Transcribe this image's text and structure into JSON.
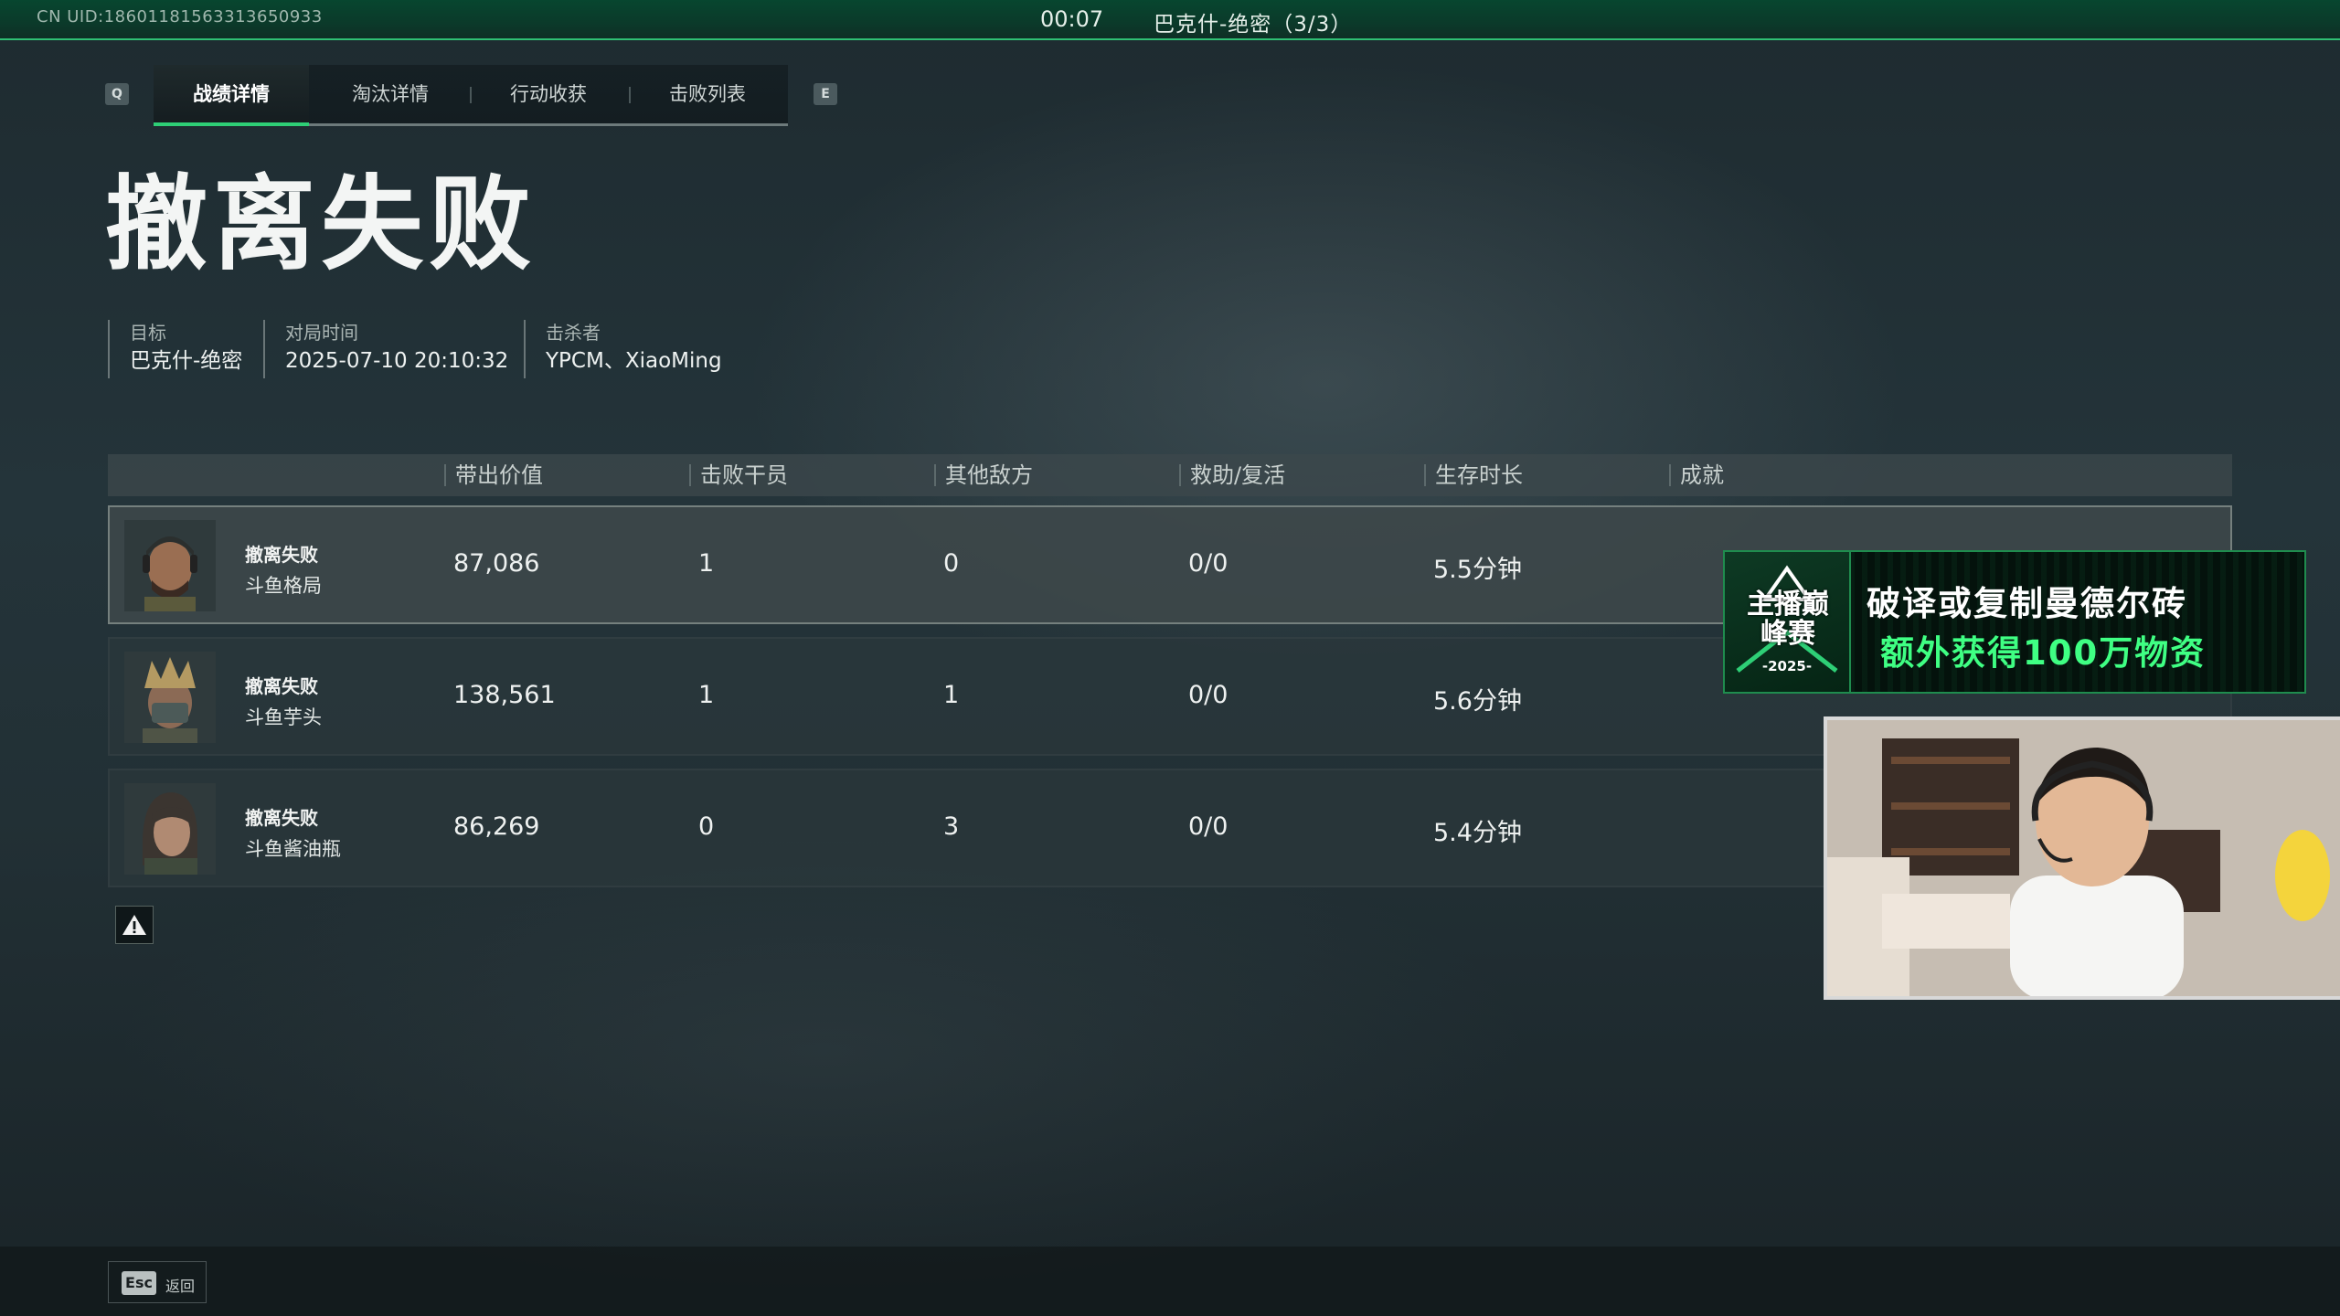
{
  "top_bar": {
    "uid": "CN UID:186011815633136509​33",
    "timer": "00:07",
    "mode": "巴克什-绝密（3/3）"
  },
  "tabs": {
    "left_key": "Q",
    "right_key": "E",
    "items": [
      {
        "label": "战绩详情",
        "active": true
      },
      {
        "label": "淘汰详情",
        "active": false
      },
      {
        "label": "行动收获",
        "active": false
      },
      {
        "label": "击败列表",
        "active": false
      }
    ]
  },
  "page_title": "撤离失败",
  "info": {
    "target_label": "目标",
    "target_value": "巴克什-绝密",
    "time_label": "对局时间",
    "time_value": "2025-07-10 20:10:32",
    "killer_label": "击杀者",
    "killer_value": "YPCM、XiaoMing"
  },
  "table": {
    "headers": [
      "带出价值",
      "击败干员",
      "其他敌方",
      "救助/复活",
      "生存时长",
      "成就"
    ],
    "rows": [
      {
        "status": "撤离失败",
        "name": "斗鱼格局",
        "value": "87,086",
        "kills": "1",
        "others": "0",
        "assist": "0/0",
        "survival": "5.5分钟"
      },
      {
        "status": "撤离失败",
        "name": "斗鱼芋头",
        "value": "138,561",
        "kills": "1",
        "others": "1",
        "assist": "0/0",
        "survival": "5.6分钟"
      },
      {
        "status": "撤离失败",
        "name": "斗鱼酱油瓶",
        "value": "86,269",
        "kills": "0",
        "others": "3",
        "assist": "0/0",
        "survival": "5.4分钟"
      }
    ]
  },
  "ad": {
    "logo_text": "主播巅峰赛",
    "logo_year": "-2025-",
    "line1": "破译或复制曼德尔砖",
    "line2": "额外获得100万物资"
  },
  "footer": {
    "esc_key": "Esc",
    "esc_label": "返回"
  },
  "colors": {
    "accent": "#2ecf76",
    "top_bar": "#07462f",
    "ad_green": "#3fff83"
  }
}
